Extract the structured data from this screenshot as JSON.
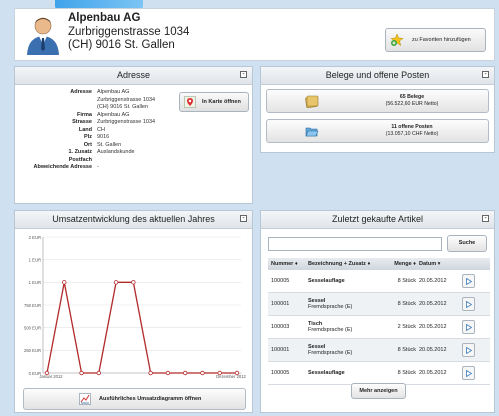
{
  "header": {
    "company_name": "Alpenbau AG",
    "street": "Zurbriggenstrasse 1034",
    "city": "(CH) 9016 St. Gallen",
    "favorites_button": "zu Favoriten hinzufügen"
  },
  "adresse": {
    "title": "Adresse",
    "fields": [
      {
        "label": "Adresse",
        "value": "Alpenbau AG"
      },
      {
        "label": "",
        "value": "Zurbriggenstrasse 1034"
      },
      {
        "label": "",
        "value": "(CH) 9016 St. Gallen"
      },
      {
        "label": "Firma",
        "value": "Alpenbau AG"
      },
      {
        "label": "Strasse",
        "value": "Zurbriggenstrasse 1034"
      },
      {
        "label": "Land",
        "value": "CH"
      },
      {
        "label": "Plz",
        "value": "9016"
      },
      {
        "label": "Ort",
        "value": "St. Gallen"
      },
      {
        "label": "1. Zusatz",
        "value": "Auslandskunde"
      },
      {
        "label": "Postfach",
        "value": ""
      },
      {
        "label": "Abweichende Adresse",
        "value": "-"
      }
    ],
    "map_button": "In Karte öffnen"
  },
  "belege": {
    "title": "Belege und offene Posten",
    "belege_count": "65 Belege",
    "belege_sum": "(56.522,60 EUR Netto)",
    "posten_count": "11 offene Posten",
    "posten_sum": "(13.057,10 CHF Netto)"
  },
  "umsatz": {
    "title": "Umsatzentwicklung des aktuellen Jahres",
    "button": "Ausführliches Umsatzdiagramm öffnen"
  },
  "chart_data": {
    "type": "line",
    "x": [
      "Januar 2012",
      "",
      "",
      "",
      "",
      "",
      "",
      "",
      "",
      "",
      "",
      "Dezember 2012"
    ],
    "x_tick_labels": [
      "Januar 2012",
      "Dezember 2012"
    ],
    "y_tick_labels": [
      "0 EUR",
      "250 EUR",
      "500 EUR",
      "750 EUR",
      "1 EUR",
      "1 EUR",
      "2 EUR"
    ],
    "series": [
      {
        "values": [
          0,
          1000,
          0,
          0,
          1000,
          1000,
          0,
          0,
          0,
          0,
          0,
          0
        ]
      }
    ],
    "ylim": [
      0,
      1500
    ],
    "grid": true,
    "line_color": "#b22a2a"
  },
  "artikel": {
    "title": "Zuletzt gekaufte Artikel",
    "search_placeholder": "",
    "search_button": "Suche",
    "columns": [
      "Nummer",
      "Bezeichnung + Zusatz",
      "Menge",
      "Datum"
    ],
    "rows": [
      {
        "nr": "100005",
        "bez": "Sesselauflage",
        "zusatz": "",
        "menge": "8 Stück",
        "datum": "20.05.2012"
      },
      {
        "nr": "100001",
        "bez": "Sessel",
        "zusatz": "Fremdsprache (E)",
        "menge": "8 Stück",
        "datum": "20.05.2012"
      },
      {
        "nr": "100003",
        "bez": "Tisch",
        "zusatz": "Fremdsprache (E)",
        "menge": "2 Stück",
        "datum": "20.05.2012"
      },
      {
        "nr": "100001",
        "bez": "Sessel",
        "zusatz": "Fremdsprache (E)",
        "menge": "8 Stück",
        "datum": "20.05.2012"
      },
      {
        "nr": "100005",
        "bez": "Sesselauflage",
        "zusatz": "",
        "menge": "8 Stück",
        "datum": "20.05.2012"
      }
    ],
    "more_button": "Mehr anzeigen"
  }
}
